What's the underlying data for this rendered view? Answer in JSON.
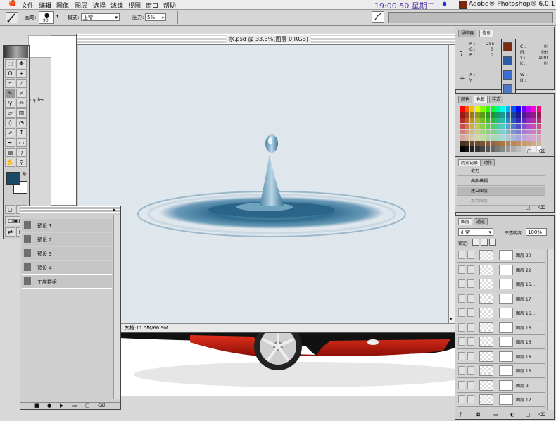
{
  "menubar": {
    "items": [
      "文件",
      "编辑",
      "图像",
      "图层",
      "选择",
      "滤镜",
      "视图",
      "窗口",
      "帮助"
    ],
    "clock": "19:00:50 星期二",
    "app_name": "Adobe® Photoshop® 6.0.1"
  },
  "options_bar": {
    "brush_label": "画笔:",
    "brush_size": "90",
    "mode_label": "模式:",
    "mode_value": "正常",
    "pressure_label": "压力:",
    "pressure_value": "5%"
  },
  "document": {
    "title": "水.psd @ 33.3%(图层 0,RGB)",
    "status": "文档:11.5M/66.9M"
  },
  "background_text": "mples",
  "actions_palette": {
    "rows": [
      "预设 1",
      "预设 2",
      "预设 3",
      "预设 4",
      "工序群组"
    ]
  },
  "navigator_palette": {
    "tabs": [
      "导航器",
      "信息"
    ],
    "rgb": {
      "R": "255",
      "G": "0",
      "B": "0"
    },
    "cmyk": {
      "C": "0!",
      "M": "99!",
      "Y": "100!",
      "K": "0!"
    },
    "xy_labels": [
      "X :",
      "Y :"
    ],
    "wh_labels": [
      "W :",
      "H :"
    ]
  },
  "color_palette": {
    "tabs": [
      "颜色",
      "色板",
      "样式"
    ]
  },
  "history_palette": {
    "tabs": [
      "历史记录",
      "动作"
    ],
    "items": [
      "载刀",
      "曲斯模糊",
      "建立图层",
      "复为图层"
    ]
  },
  "layers_palette": {
    "tabs": [
      "图层",
      "通道"
    ],
    "mode": "正常",
    "opacity_label": "不透明度:",
    "opacity_value": "100%",
    "lock_label": "锁定:",
    "layers": [
      "图层 20",
      "图层 22",
      "图层 16...",
      "图层 17",
      "图层 16...",
      "图层 16...",
      "图层 16",
      "图层 18",
      "图层 13",
      "图层 9",
      "图层 12"
    ]
  },
  "colors": {
    "foreground": "#1a4a66",
    "background": "#ffffff",
    "water_dark": "#2f6c8f",
    "car_red": "#c81a0e"
  }
}
